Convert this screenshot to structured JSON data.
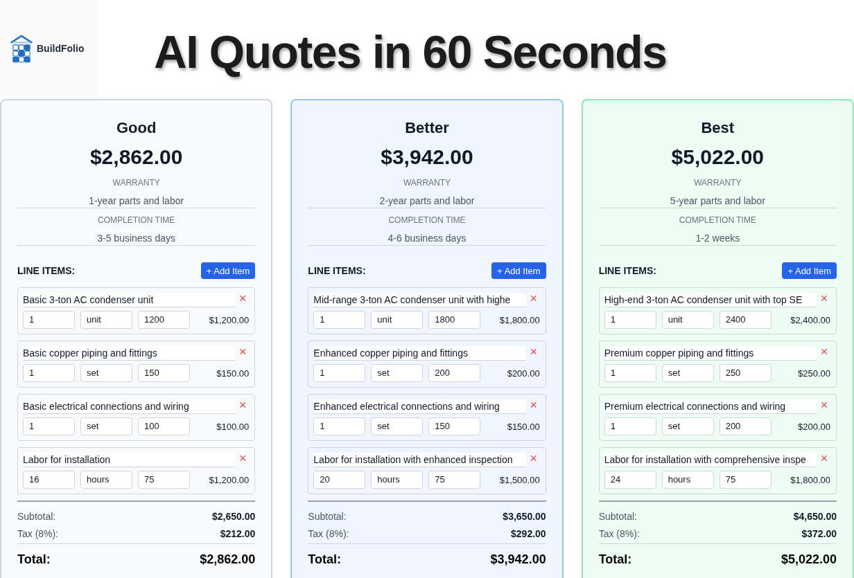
{
  "brand": {
    "name": "BuildFolio"
  },
  "headline": "AI Quotes in 60 Seconds",
  "tiers": [
    {
      "name": "Good",
      "color": "#d1d5db",
      "price": "$2,862.00",
      "details": [
        {
          "label": "WARRANTY",
          "value": "1-year parts and labor"
        },
        {
          "label": "COMPLETION TIME",
          "value": "3-5 business days"
        }
      ],
      "line_items_heading": "LINE ITEMS:",
      "add_button": "+ Add Item",
      "line_items": [
        {
          "description": "Basic 3-ton AC condenser unit",
          "quantity": "1",
          "unit": "unit",
          "rate": "1200",
          "amount": "$1,200.00",
          "remove": "×"
        },
        {
          "description": "Basic copper piping and fittings",
          "quantity": "1",
          "unit": "set",
          "rate": "150",
          "amount": "$150.00",
          "remove": "×"
        },
        {
          "description": "Basic electrical connections and wiring",
          "quantity": "1",
          "unit": "set",
          "rate": "100",
          "amount": "$100.00",
          "remove": "×"
        },
        {
          "description": "Labor for installation",
          "quantity": "16",
          "unit": "hours",
          "rate": "75",
          "amount": "$1,200.00",
          "remove": "×"
        }
      ],
      "summary": [
        {
          "label": "Subtotal:",
          "value": "$2,650.00"
        },
        {
          "label": "Tax (8%):",
          "value": "$212.00"
        }
      ],
      "total": {
        "label": "Total:",
        "value": "$2,862.00"
      }
    },
    {
      "name": "Better",
      "color": "#93c5fd",
      "price": "$3,942.00",
      "details": [
        {
          "label": "WARRANTY",
          "value": "2-year parts and labor"
        },
        {
          "label": "COMPLETION TIME",
          "value": "4-6 business days"
        }
      ],
      "line_items_heading": "LINE ITEMS:",
      "add_button": "+ Add Item",
      "line_items": [
        {
          "description": "Mid-range 3-ton AC condenser unit with highe",
          "quantity": "1",
          "unit": "unit",
          "rate": "1800",
          "amount": "$1,800.00",
          "remove": "×"
        },
        {
          "description": "Enhanced copper piping and fittings",
          "quantity": "1",
          "unit": "set",
          "rate": "200",
          "amount": "$200.00",
          "remove": "×"
        },
        {
          "description": "Enhanced electrical connections and wiring",
          "quantity": "1",
          "unit": "set",
          "rate": "150",
          "amount": "$150.00",
          "remove": "×"
        },
        {
          "description": "Labor for installation with enhanced inspection",
          "quantity": "20",
          "unit": "hours",
          "rate": "75",
          "amount": "$1,500.00",
          "remove": "×"
        }
      ],
      "summary": [
        {
          "label": "Subtotal:",
          "value": "$3,650.00"
        },
        {
          "label": "Tax (8%):",
          "value": "$292.00"
        }
      ],
      "total": {
        "label": "Total:",
        "value": "$3,942.00"
      }
    },
    {
      "name": "Best",
      "color": "#86efac",
      "price": "$5,022.00",
      "details": [
        {
          "label": "WARRANTY",
          "value": "5-year parts and labor"
        },
        {
          "label": "COMPLETION TIME",
          "value": "1-2 weeks"
        }
      ],
      "line_items_heading": "LINE ITEMS:",
      "add_button": "+ Add Item",
      "line_items": [
        {
          "description": "High-end 3-ton AC condenser unit with top SE",
          "quantity": "1",
          "unit": "unit",
          "rate": "2400",
          "amount": "$2,400.00",
          "remove": "×"
        },
        {
          "description": "Premium copper piping and fittings",
          "quantity": "1",
          "unit": "set",
          "rate": "250",
          "amount": "$250.00",
          "remove": "×"
        },
        {
          "description": "Premium electrical connections and wiring",
          "quantity": "1",
          "unit": "set",
          "rate": "200",
          "amount": "$200.00",
          "remove": "×"
        },
        {
          "description": "Labor for installation with comprehensive inspe",
          "quantity": "24",
          "unit": "hours",
          "rate": "75",
          "amount": "$1,800.00",
          "remove": "×"
        }
      ],
      "summary": [
        {
          "label": "Subtotal:",
          "value": "$4,650.00"
        },
        {
          "label": "Tax (8%):",
          "value": "$372.00"
        }
      ],
      "total": {
        "label": "Total:",
        "value": "$5,022.00"
      }
    }
  ]
}
